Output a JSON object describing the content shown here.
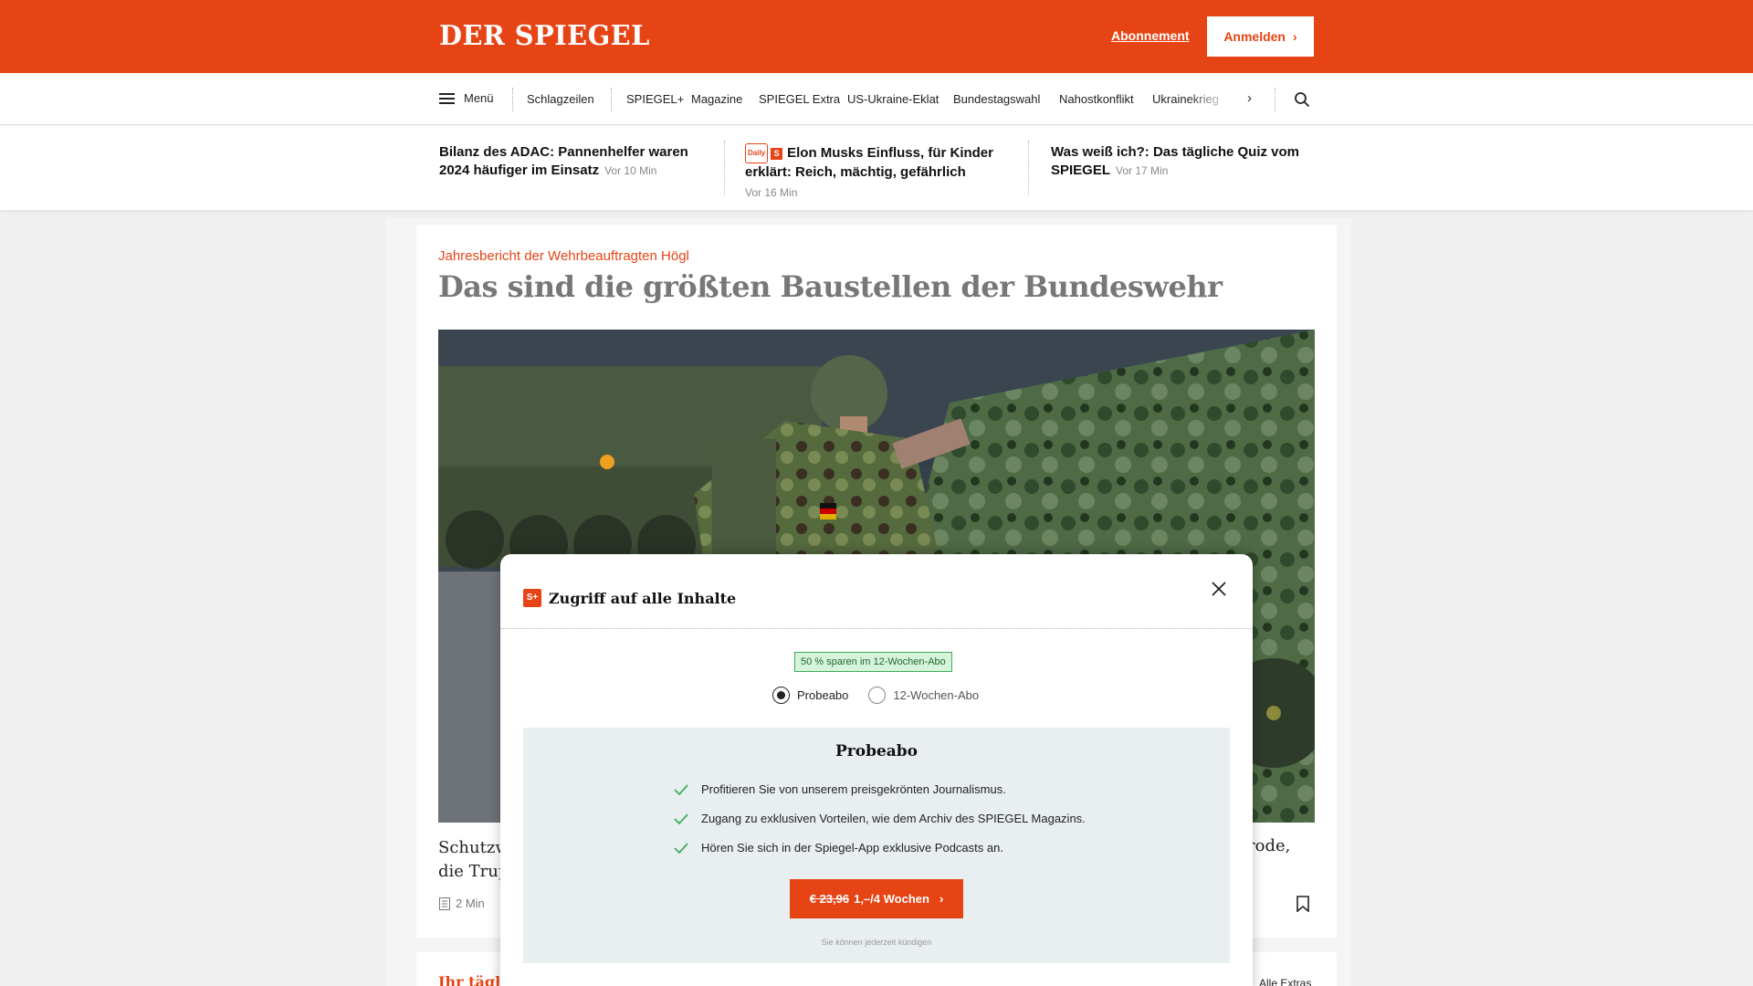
{
  "header": {
    "logo": "DER SPIEGEL",
    "subscription_link": "Abonnement",
    "login_label": "Anmelden",
    "login_chevron": "›"
  },
  "nav": {
    "menu_label": "Menü",
    "items": [
      "Schlagzeilen",
      "SPIEGEL+",
      "Magazine",
      "SPIEGEL Extra",
      "US-Ukraine-Eklat",
      "Bundestagswahl",
      "Nahostkonflikt",
      "Ukrainekrieg"
    ],
    "next_glyph": "›"
  },
  "headlines": [
    {
      "title": "Bilanz des ADAC: Pannenhelfer waren 2024 häufiger im Einsatz",
      "time": "Vor 10 Min"
    },
    {
      "tag": "Daily",
      "badge": "S",
      "title": "Elon Musks Einfluss, für Kinder erklärt: Reich, mächtig, gefährlich",
      "time": "Vor 16 Min"
    },
    {
      "title": "Was weiß ich?: Das tägliche Quiz vom SPIEGEL",
      "time": "Vor 17 Min"
    }
  ],
  "article": {
    "kicker": "Jahresbericht der Wehrbeauftragten Högl",
    "title": "Das sind die größten Baustellen der Bundeswehr",
    "teaser_left_1": "Schutzwe",
    "teaser_left_2": "die Trup",
    "teaser_right": "rode,",
    "read_time": "2 Min"
  },
  "next_card": {
    "kicker": "Ihr täglic",
    "right_link": "Alle Extras"
  },
  "modal": {
    "splus_badge": "S+",
    "title": "Zugriff auf alle Inhalte",
    "save_badge": "50 % sparen im 12-Wochen-Abo",
    "options": [
      "Probeabo",
      "12-Wochen-Abo"
    ],
    "selected_option": "Probeabo",
    "plan_title": "Probeabo",
    "benefits": [
      "Profitieren Sie von unserem preisgekrönten Journalismus.",
      "Zugang zu exklusiven Vorteilen, wie dem Archiv des SPIEGEL Magazins.",
      "Hören Sie sich in der Spiegel-App exklusive Podcasts an."
    ],
    "cta_old_price": "€ 23,96",
    "cta_new_price": "1,–/4 Wochen",
    "cta_chevron": "›",
    "cancel_note": "Sie können jederzeit kündigen"
  },
  "colors": {
    "brand": "#e64415",
    "check_green": "#3fae57",
    "plan_bg": "#e9eff1"
  },
  "icons": [
    "hamburger-icon",
    "search-icon",
    "chevron-right-icon",
    "close-icon",
    "check-icon",
    "bookmark-icon",
    "article-icon",
    "splus-icon"
  ]
}
